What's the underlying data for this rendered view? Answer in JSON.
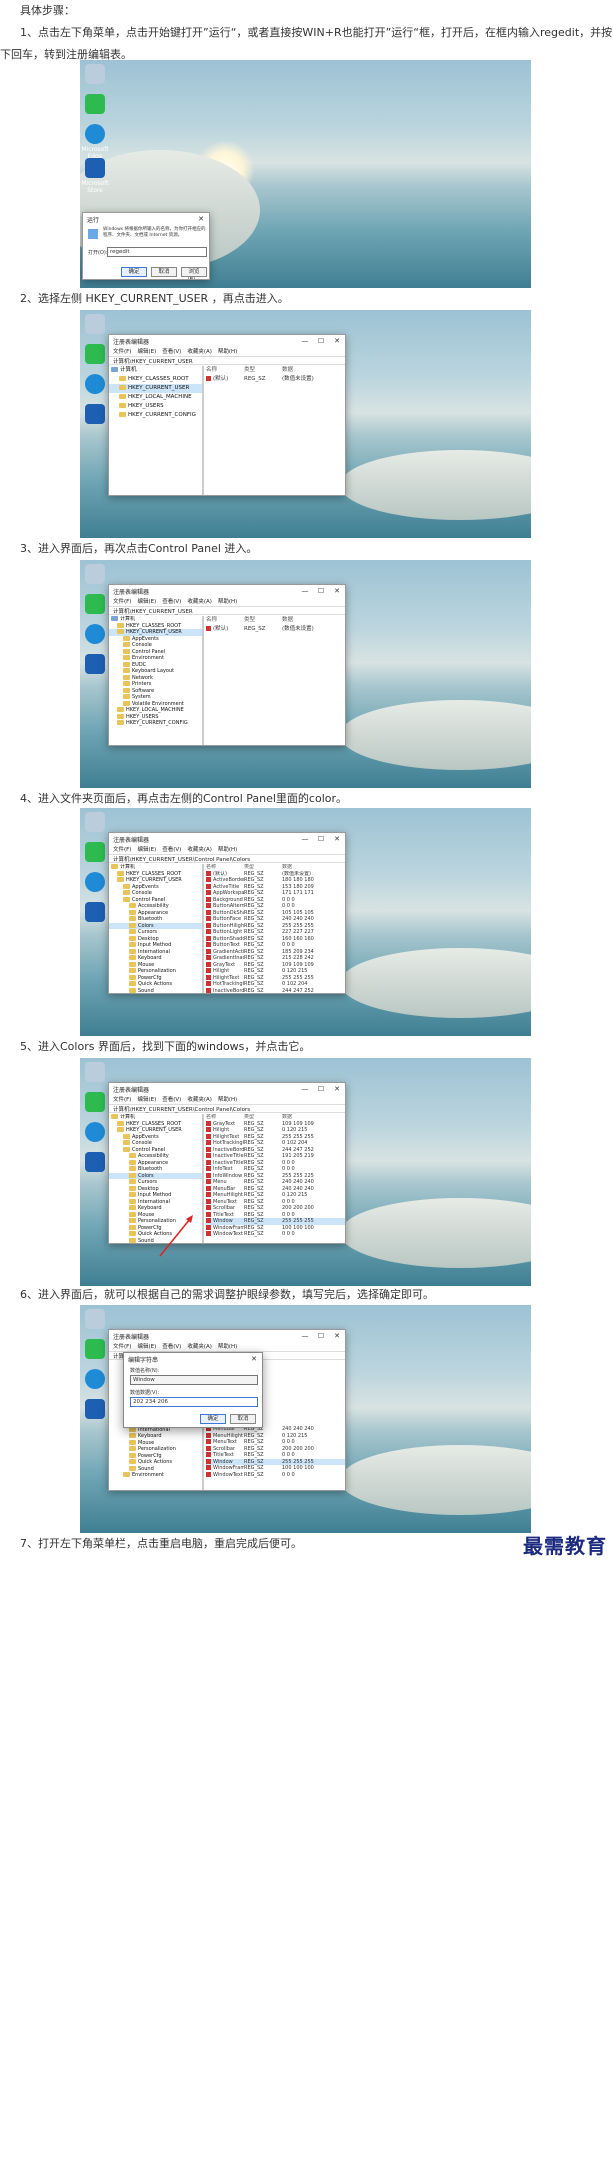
{
  "heading": "具体步骤：",
  "steps": [
    "1、点击左下角菜单，点击开始键打开”运行“，或者直接按WIN+R也能打开”运行“框，打开后，在框内输入regedit，并按下回车，转到注册编辑表。",
    "2、选择左侧 HKEY_CURRENT_USER ，再点击进入。",
    "3、进入界面后，再次点击Control Panel 进入。",
    "4、进入文件夹页面后，再点击左侧的Control Panel里面的color。",
    "5、进入Colors 界面后，找到下面的windows，并点击它。",
    "6、进入界面后，就可以根据自己的需求调整护眼绿参数，填写完后，选择确定即可。",
    "7、打开左下角菜单栏，点击重启电脑，重启完成后便可。"
  ],
  "desktop_icons": [
    "回收站",
    "",
    "Microsoft Edge",
    "Microsoft Store"
  ],
  "run_dialog": {
    "title": "运行",
    "desc": "Windows 将根据你所输入的名称，为你打开相应的程序、文件夹、文档或 Internet 资源。",
    "open_label": "打开(O):",
    "value": "regedit",
    "ok": "确定",
    "cancel": "取消",
    "browse": "浏览(B)..."
  },
  "regedit": {
    "title": "注册表编辑器",
    "menu": [
      "文件(F)",
      "编辑(E)",
      "查看(V)",
      "收藏夹(A)",
      "帮助(H)"
    ],
    "addr2": "计算机\\HKEY_CURRENT_USER",
    "addr4": "计算机\\HKEY_CURRENT_USER\\Control Panel\\Colors",
    "cols": [
      "名称",
      "类型",
      "数据"
    ],
    "default_row": [
      "(默认)",
      "REG_SZ",
      "(数值未设置)"
    ],
    "tree2": [
      "计算机",
      "HKEY_CLASSES_ROOT",
      "HKEY_CURRENT_USER",
      "HKEY_LOCAL_MACHINE",
      "HKEY_USERS",
      "HKEY_CURRENT_CONFIG"
    ],
    "tree3": [
      "计算机",
      "HKEY_CLASSES_ROOT",
      "HKEY_CURRENT_USER",
      "AppEvents",
      "Console",
      "Control Panel",
      "Environment",
      "EUDC",
      "Keyboard Layout",
      "Network",
      "Printers",
      "Software",
      "System",
      "Volatile Environment",
      "HKEY_LOCAL_MACHINE",
      "HKEY_USERS",
      "HKEY_CURRENT_CONFIG"
    ],
    "tree4": [
      "计算机",
      "HKEY_CLASSES_ROOT",
      "HKEY_CURRENT_USER",
      "AppEvents",
      "Console",
      "Control Panel",
      "Accessibility",
      "Appearance",
      "Bluetooth",
      "Colors",
      "Cursors",
      "Desktop",
      "Input Method",
      "International",
      "Keyboard",
      "Mouse",
      "Personalization",
      "PowerCfg",
      "Quick Actions",
      "Sound",
      "Environment"
    ],
    "colors4": [
      [
        "(默认)",
        "REG_SZ",
        "(数值未设置)"
      ],
      [
        "ActiveBorder",
        "REG_SZ",
        "180 180 180"
      ],
      [
        "ActiveTitle",
        "REG_SZ",
        "153 180 209"
      ],
      [
        "AppWorkspace",
        "REG_SZ",
        "171 171 171"
      ],
      [
        "Background",
        "REG_SZ",
        "0 0 0"
      ],
      [
        "ButtonAlternat...",
        "REG_SZ",
        "0 0 0"
      ],
      [
        "ButtonDkShad...",
        "REG_SZ",
        "105 105 105"
      ],
      [
        "ButtonFace",
        "REG_SZ",
        "240 240 240"
      ],
      [
        "ButtonHilight",
        "REG_SZ",
        "255 255 255"
      ],
      [
        "ButtonLight",
        "REG_SZ",
        "227 227 227"
      ],
      [
        "ButtonShadow",
        "REG_SZ",
        "160 160 160"
      ],
      [
        "ButtonText",
        "REG_SZ",
        "0 0 0"
      ],
      [
        "GradientActive...",
        "REG_SZ",
        "185 209 234"
      ],
      [
        "GradientInacti...",
        "REG_SZ",
        "215 228 242"
      ],
      [
        "GrayText",
        "REG_SZ",
        "109 109 109"
      ],
      [
        "Hilight",
        "REG_SZ",
        "0 120 215"
      ],
      [
        "HilightText",
        "REG_SZ",
        "255 255 255"
      ],
      [
        "HotTrackingCo...",
        "REG_SZ",
        "0 102 204"
      ],
      [
        "InactiveBorder",
        "REG_SZ",
        "244 247 252"
      ]
    ],
    "colors5": [
      [
        "GrayText",
        "REG_SZ",
        "109 109 109"
      ],
      [
        "Hilight",
        "REG_SZ",
        "0 120 215"
      ],
      [
        "HilightText",
        "REG_SZ",
        "255 255 255"
      ],
      [
        "HotTrackingCo...",
        "REG_SZ",
        "0 102 204"
      ],
      [
        "InactiveBorder",
        "REG_SZ",
        "244 247 252"
      ],
      [
        "InactiveTitle",
        "REG_SZ",
        "191 205 219"
      ],
      [
        "InactiveTitleText",
        "REG_SZ",
        "0 0 0"
      ],
      [
        "InfoText",
        "REG_SZ",
        "0 0 0"
      ],
      [
        "InfoWindow",
        "REG_SZ",
        "255 255 225"
      ],
      [
        "Menu",
        "REG_SZ",
        "240 240 240"
      ],
      [
        "MenuBar",
        "REG_SZ",
        "240 240 240"
      ],
      [
        "MenuHilight",
        "REG_SZ",
        "0 120 215"
      ],
      [
        "MenuText",
        "REG_SZ",
        "0 0 0"
      ],
      [
        "Scrollbar",
        "REG_SZ",
        "200 200 200"
      ],
      [
        "TitleText",
        "REG_SZ",
        "0 0 0"
      ],
      [
        "Window",
        "REG_SZ",
        "255 255 255"
      ],
      [
        "WindowFrame",
        "REG_SZ",
        "100 100 100"
      ],
      [
        "WindowText",
        "REG_SZ",
        "0 0 0"
      ]
    ],
    "colors6": [
      [
        "MenuBar",
        "REG_SZ",
        "240 240 240"
      ],
      [
        "MenuHilight",
        "REG_SZ",
        "0 120 215"
      ],
      [
        "MenuText",
        "REG_SZ",
        "0 0 0"
      ],
      [
        "Scrollbar",
        "REG_SZ",
        "200 200 200"
      ],
      [
        "TitleText",
        "REG_SZ",
        "0 0 0"
      ],
      [
        "Window",
        "REG_SZ",
        "255 255 255"
      ],
      [
        "WindowFrame",
        "REG_SZ",
        "100 100 100"
      ],
      [
        "WindowText",
        "REG_SZ",
        "0 0 0"
      ]
    ],
    "tree6": [
      "Input Method",
      "International",
      "Keyboard",
      "Mouse",
      "Personalization",
      "PowerCfg",
      "Quick Actions",
      "Sound",
      "Environment"
    ]
  },
  "edit_dialog": {
    "title": "编辑字符串",
    "name_label": "数值名称(N):",
    "name_value": "Window",
    "data_label": "数值数据(V):",
    "data_value": "202 234 206",
    "ok": "确定",
    "cancel": "取消"
  },
  "brand": "最需教育",
  "colors": {
    "accent": "#3b78d8",
    "brand": "#1b2a7e",
    "arrow": "#d22"
  }
}
